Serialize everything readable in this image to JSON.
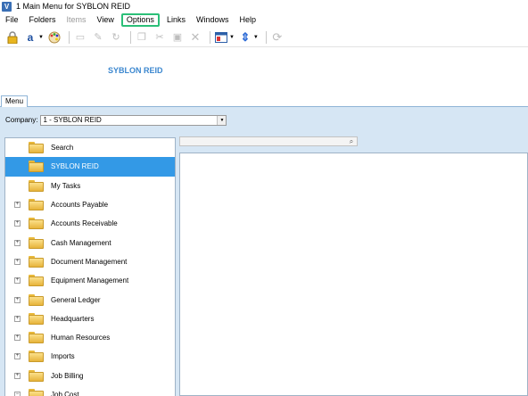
{
  "window": {
    "title": "1 Main Menu for SYBLON REID",
    "app_icon_letter": "V"
  },
  "menubar": {
    "items": [
      {
        "label": "File",
        "state": "normal"
      },
      {
        "label": "Folders",
        "state": "normal"
      },
      {
        "label": "Items",
        "state": "disabled"
      },
      {
        "label": "View",
        "state": "normal"
      },
      {
        "label": "Options",
        "state": "highlighted"
      },
      {
        "label": "Links",
        "state": "normal"
      },
      {
        "label": "Windows",
        "state": "normal"
      },
      {
        "label": "Help",
        "state": "normal"
      }
    ]
  },
  "toolbar": {
    "icons": [
      "lock-icon",
      "font-icon",
      "palette-icon",
      "folder-icon",
      "edit-icon",
      "refresh-small-icon",
      "copy-icon",
      "cut-icon",
      "paste-icon",
      "delete-icon",
      "layout-icon",
      "sort-icon",
      "refresh-icon"
    ]
  },
  "header": {
    "company_name": "SYBLON REID"
  },
  "tabs": [
    {
      "label": "Menu"
    }
  ],
  "company_bar": {
    "label": "Company:",
    "selected_value": "1 - SYBLON REID"
  },
  "search": {
    "placeholder": ""
  },
  "tree": {
    "items": [
      {
        "label": "Search",
        "expandable": false,
        "expanded": false,
        "selected": false
      },
      {
        "label": "SYBLON REID",
        "expandable": false,
        "expanded": false,
        "selected": true
      },
      {
        "label": "My Tasks",
        "expandable": false,
        "expanded": false,
        "selected": false
      },
      {
        "label": "Accounts Payable",
        "expandable": true,
        "expanded": false,
        "selected": false
      },
      {
        "label": "Accounts Receivable",
        "expandable": true,
        "expanded": false,
        "selected": false
      },
      {
        "label": "Cash Management",
        "expandable": true,
        "expanded": false,
        "selected": false
      },
      {
        "label": "Document Management",
        "expandable": true,
        "expanded": false,
        "selected": false
      },
      {
        "label": "Equipment Management",
        "expandable": true,
        "expanded": false,
        "selected": false
      },
      {
        "label": "General Ledger",
        "expandable": true,
        "expanded": false,
        "selected": false
      },
      {
        "label": "Headquarters",
        "expandable": true,
        "expanded": false,
        "selected": false
      },
      {
        "label": "Human Resources",
        "expandable": true,
        "expanded": false,
        "selected": false
      },
      {
        "label": "Imports",
        "expandable": true,
        "expanded": false,
        "selected": false
      },
      {
        "label": "Job Billing",
        "expandable": true,
        "expanded": false,
        "selected": false
      },
      {
        "label": "Job Cost",
        "expandable": true,
        "expanded": true,
        "selected": false
      }
    ]
  },
  "colors": {
    "highlight_box": "#2bbf78",
    "selection": "#3399e6",
    "heading_blue": "#3b87cf",
    "panel_background": "#d6e6f4"
  }
}
